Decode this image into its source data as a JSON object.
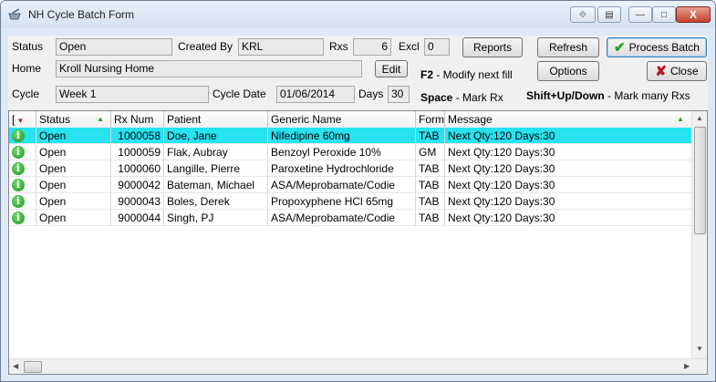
{
  "window": {
    "title": "NH Cycle Batch Form",
    "controls": [
      "⟐",
      "▤",
      "—",
      "□",
      "X"
    ]
  },
  "form": {
    "status_label": "Status",
    "status_value": "Open",
    "created_by_label": "Created By",
    "created_by_value": "KRL",
    "rxs_label": "Rxs",
    "rxs_value": "6",
    "excl_label": "Excl",
    "excl_value": "0",
    "home_label": "Home",
    "home_value": "Kroll Nursing Home",
    "edit_label": "Edit",
    "cycle_label": "Cycle",
    "cycle_value": "Week 1",
    "cycle_date_label": "Cycle Date",
    "cycle_date_value": "01/06/2014",
    "days_label": "Days",
    "days_value": "30"
  },
  "buttons": {
    "reports": "Reports",
    "refresh": "Refresh",
    "process_batch": "Process Batch",
    "options": "Options",
    "close": "Close"
  },
  "hints": {
    "f2_key": "F2",
    "f2_text": " - Modify next fill",
    "space_key": "Space",
    "space_text": " - Mark Rx",
    "shift_key": "Shift+Up/Down",
    "shift_text": " - Mark many Rxs"
  },
  "table": {
    "headers": [
      "[",
      "Status",
      "Rx Num",
      "Patient",
      "Generic Name",
      "Form",
      "Message"
    ],
    "rows": [
      {
        "status": "Open",
        "rx": "1000058",
        "patient": "Doe, Jane",
        "generic": "Nifedipine 60mg",
        "form": "TAB",
        "message": "Next Qty:120 Days:30"
      },
      {
        "status": "Open",
        "rx": "1000059",
        "patient": "Flak, Aubray",
        "generic": "Benzoyl Peroxide 10%",
        "form": "GM",
        "message": "Next Qty:120 Days:30"
      },
      {
        "status": "Open",
        "rx": "1000060",
        "patient": "Langille, Pierre",
        "generic": "Paroxetine Hydrochloride",
        "form": "TAB",
        "message": "Next Qty:120 Days:30"
      },
      {
        "status": "Open",
        "rx": "9000042",
        "patient": "Bateman, Michael",
        "generic": "ASA/Meprobamate/Codie",
        "form": "TAB",
        "message": "Next Qty:120 Days:30"
      },
      {
        "status": "Open",
        "rx": "9000043",
        "patient": "Boles, Derek",
        "generic": "Propoxyphene HCl 65mg",
        "form": "TAB",
        "message": "Next Qty:120 Days:30"
      },
      {
        "status": "Open",
        "rx": "9000044",
        "patient": "Singh, PJ",
        "generic": "ASA/Meprobamate/Codie",
        "form": "TAB",
        "message": "Next Qty:120 Days:30"
      }
    ]
  },
  "colors": {
    "selected_row": "#27e3f0",
    "accent_green": "#19a319",
    "close_red": "#c0101a"
  }
}
